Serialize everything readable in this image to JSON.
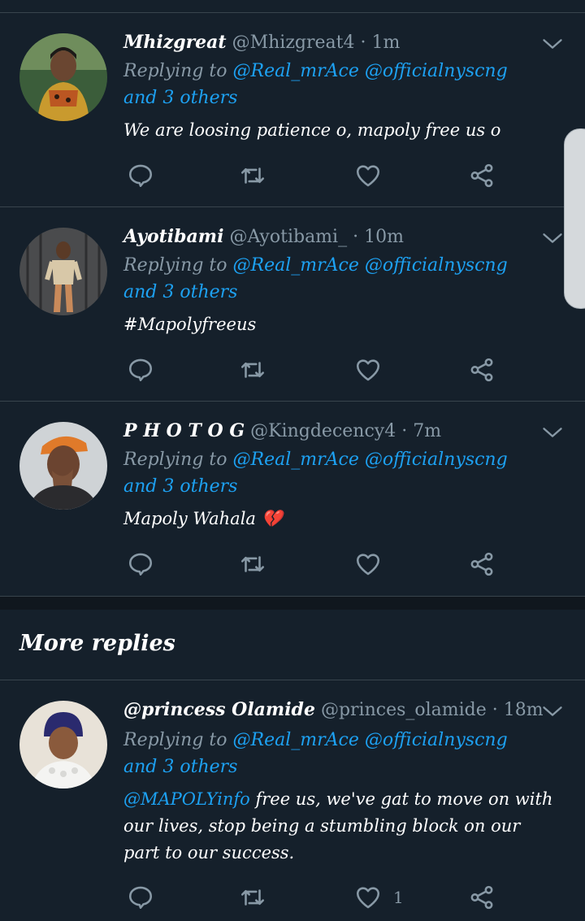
{
  "colors": {
    "background": "#15202b",
    "divider": "#38444d",
    "link": "#1da1f2",
    "muted": "#8899a6"
  },
  "icons": {
    "reply": "speech-bubble-icon",
    "retweet": "retweet-icon",
    "like": "heart-icon",
    "share": "share-icon",
    "more": "chevron-down-icon"
  },
  "tweets": [
    {
      "name": "Mhizgreat",
      "handle": "@Mhizgreat4",
      "sep": "·",
      "time": "1m",
      "reply_prefix": "Replying to ",
      "reply_links": "@Real_mrAce @officialnyscng and 3 others",
      "text": "We are loosing patience o, mapoly free us o",
      "like_count": ""
    },
    {
      "name": "Ayotibami",
      "handle": "@Ayotibami_",
      "sep": "·",
      "time": "10m",
      "reply_prefix": "Replying to ",
      "reply_links": "@Real_mrAce @officialnyscng and 3 others",
      "text": "#Mapolyfreeus",
      "like_count": ""
    },
    {
      "name": "P H O T O G",
      "handle": "@Kingdecency4",
      "sep": "·",
      "time": "7m",
      "reply_prefix": "Replying to ",
      "reply_links": "@Real_mrAce @officialnyscng and 3 others",
      "text": "Mapoly Wahala 💔",
      "like_count": ""
    }
  ],
  "more_replies": {
    "title": "More replies",
    "tweets": [
      {
        "name": "@princess Olamide",
        "handle": "@princes_olamide",
        "sep": "·",
        "time": "18m",
        "reply_prefix": "Replying to ",
        "reply_links": "@Real_mrAce @officialnyscng and 3 others",
        "mention": "@MAPOLYinfo",
        "text": " free us, we've gat to move on with our lives, stop being a stumbling block on our part to our success.",
        "like_count": "1"
      }
    ]
  }
}
